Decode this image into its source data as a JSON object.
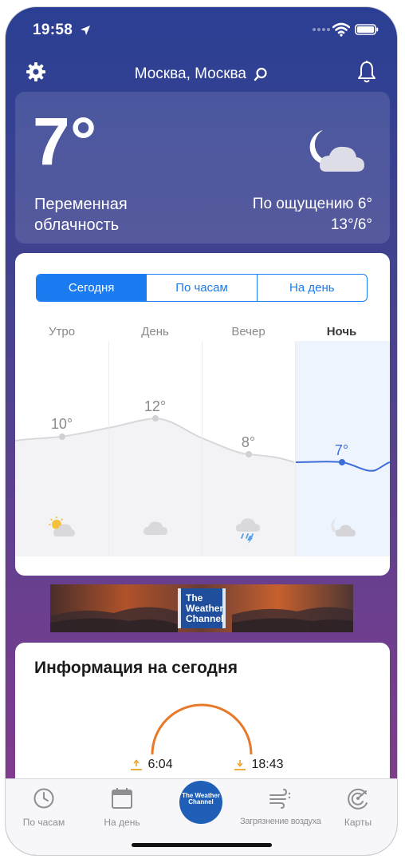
{
  "status_bar": {
    "time": "19:58"
  },
  "header": {
    "location": "Москва, Москва"
  },
  "current": {
    "temperature": "7°",
    "condition": "Переменная облачность",
    "feels_like": "По ощущению 6°",
    "high_low": "13°/6°"
  },
  "forecast": {
    "tabs": [
      "Сегодня",
      "По часам",
      "На день"
    ],
    "active_tab": "Сегодня",
    "periods": [
      {
        "name": "Утро",
        "temp": "10°",
        "icon": "sun-cloud-icon"
      },
      {
        "name": "День",
        "temp": "12°",
        "icon": "cloud-icon"
      },
      {
        "name": "Вечер",
        "temp": "8°",
        "icon": "rain-cloud-icon"
      },
      {
        "name": "Ночь",
        "temp": "7°",
        "icon": "moon-cloud-icon"
      }
    ],
    "active_period": "Ночь"
  },
  "ad": {
    "logo_text": "The Weather Channel"
  },
  "today_info": {
    "title": "Информация на сегодня",
    "sunrise": "6:04",
    "sunset": "18:43"
  },
  "tab_bar": {
    "items": [
      {
        "label": "По часам",
        "icon": "clock-icon"
      },
      {
        "label": "На день",
        "icon": "calendar-icon"
      },
      {
        "label": "The Weather Channel",
        "icon": "twc-logo"
      },
      {
        "label": "Загрязнение воздуха",
        "icon": "wind-icon"
      },
      {
        "label": "Карты",
        "icon": "radar-icon"
      }
    ]
  },
  "colors": {
    "accent": "#1a7cf0",
    "night_line": "#3d6dd8",
    "sun_arc": "#e8782a"
  }
}
